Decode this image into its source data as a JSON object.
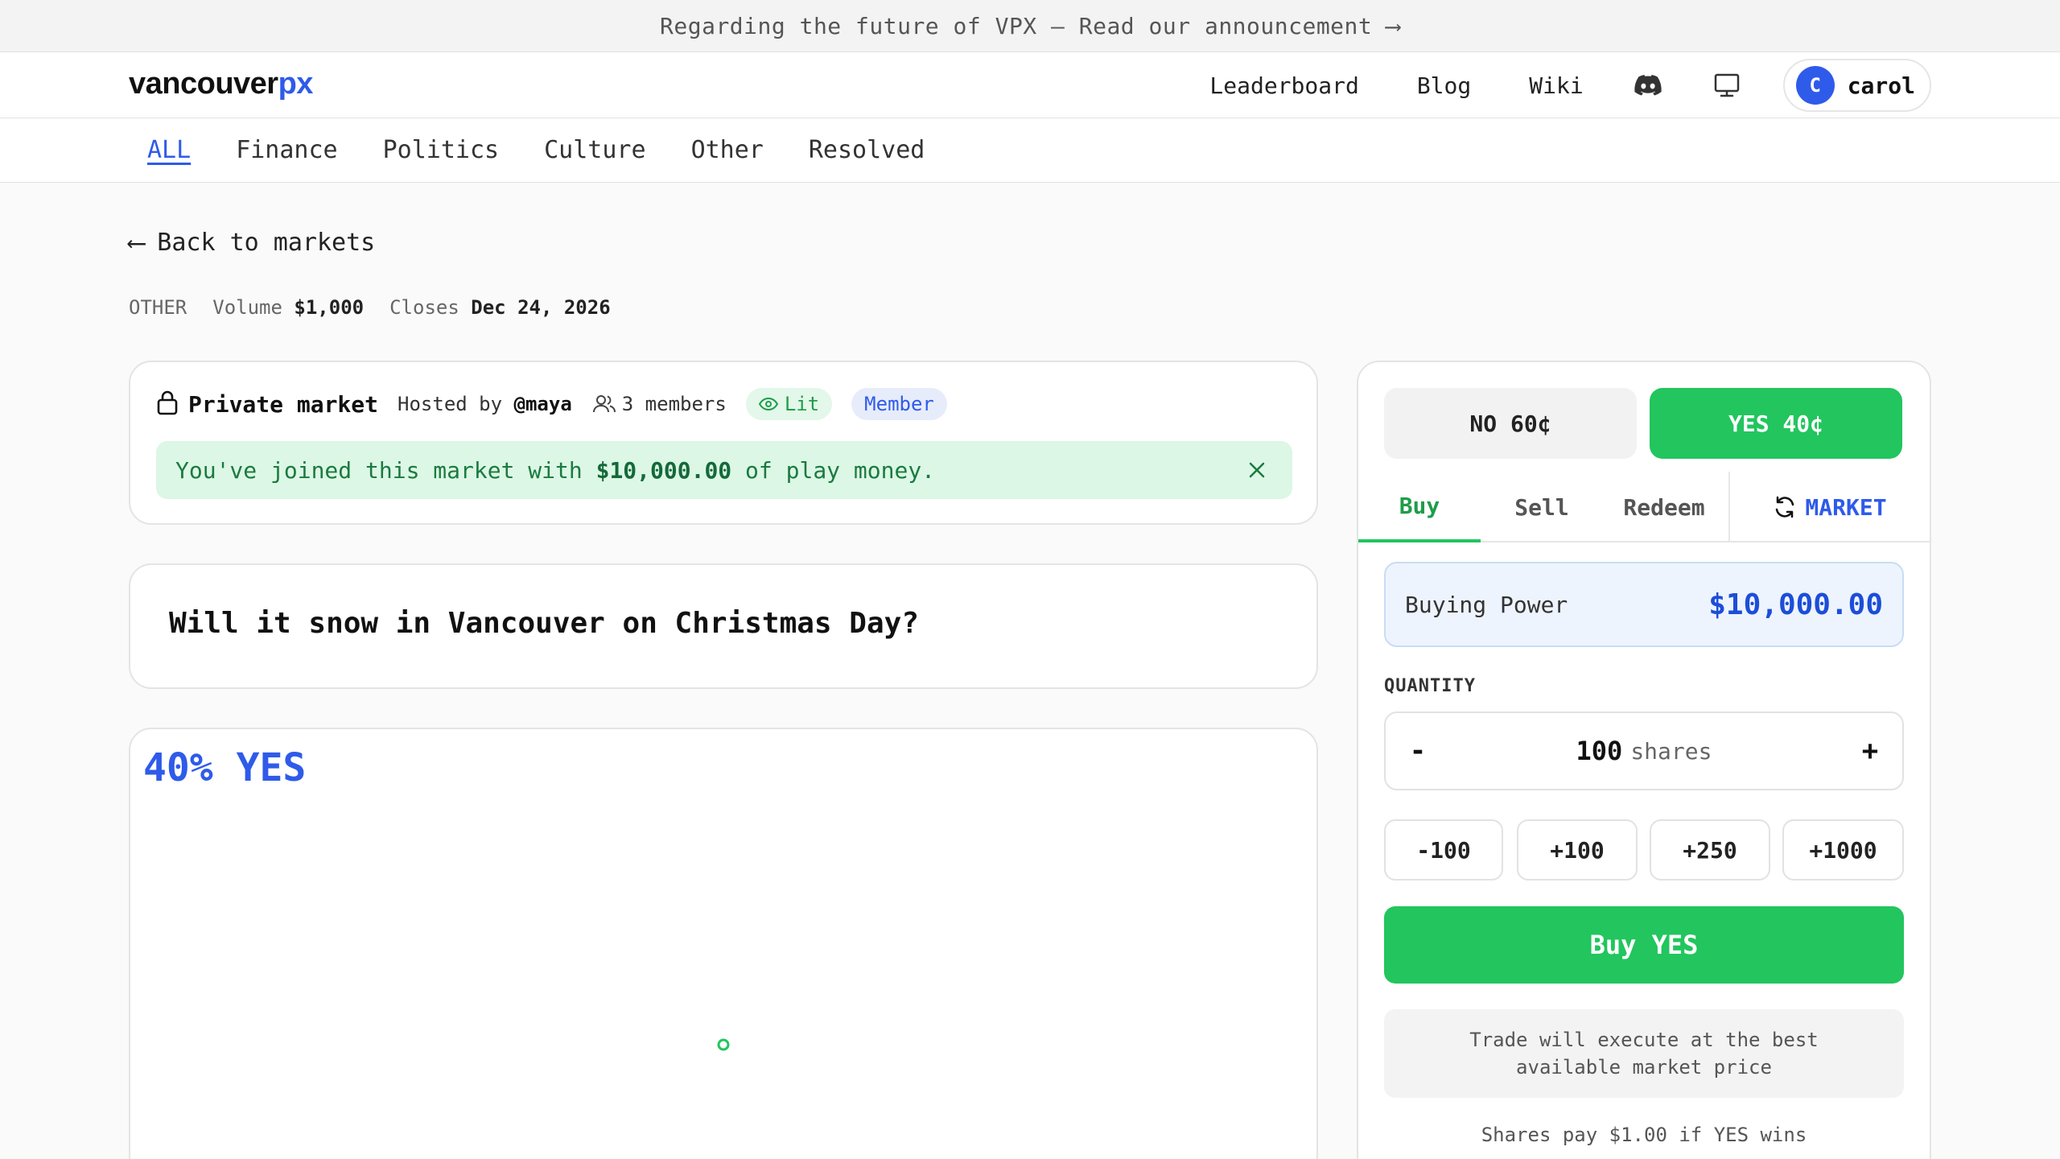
{
  "announcement": "Regarding the future of VPX — Read our announcement ⟶",
  "header": {
    "logo_main": "vancouver",
    "logo_accent": "px",
    "nav": [
      "Leaderboard",
      "Blog",
      "Wiki"
    ],
    "icons": [
      "discord-icon",
      "monitor-icon"
    ],
    "user": {
      "initial": "C",
      "name": "carol"
    }
  },
  "categories": [
    "ALL",
    "Finance",
    "Politics",
    "Culture",
    "Other",
    "Resolved"
  ],
  "back_label": "Back to markets",
  "meta": {
    "category": "OTHER",
    "volume_label": "Volume",
    "volume_value": "$1,000",
    "closes_label": "Closes",
    "closes_value": "Dec 24, 2026"
  },
  "private_market": {
    "title": "Private market",
    "hosted_label": "Hosted by",
    "host": "@maya",
    "members": "3 members",
    "lit_badge": "Lit",
    "member_badge": "Member",
    "joined_prefix": "You've joined this market with",
    "joined_amount": "$10,000.00",
    "joined_suffix": "of play money."
  },
  "question": "Will it snow in Vancouver on Christmas Day?",
  "probability_label": "40% YES",
  "chart_data": {
    "type": "line",
    "series": [
      {
        "values": [
          40
        ]
      }
    ]
  },
  "trade": {
    "no_label": "NO 60¢",
    "yes_label": "YES 40¢",
    "tabs": [
      "Buy",
      "Sell",
      "Redeem"
    ],
    "order_type": "MARKET",
    "buying_power_label": "Buying Power",
    "buying_power_value": "$10,000.00",
    "quantity_label": "QUANTITY",
    "quantity_value": "100",
    "quantity_unit": "shares",
    "minus": "-",
    "plus": "+",
    "quick": [
      "-100",
      "+100",
      "+250",
      "+1000"
    ],
    "buy_button": "Buy YES",
    "note": "Trade will execute at the best available market price",
    "payout": "Shares pay $1.00 if YES wins"
  },
  "colors": {
    "accent": "#2f5bea",
    "yes": "#22c55e"
  }
}
